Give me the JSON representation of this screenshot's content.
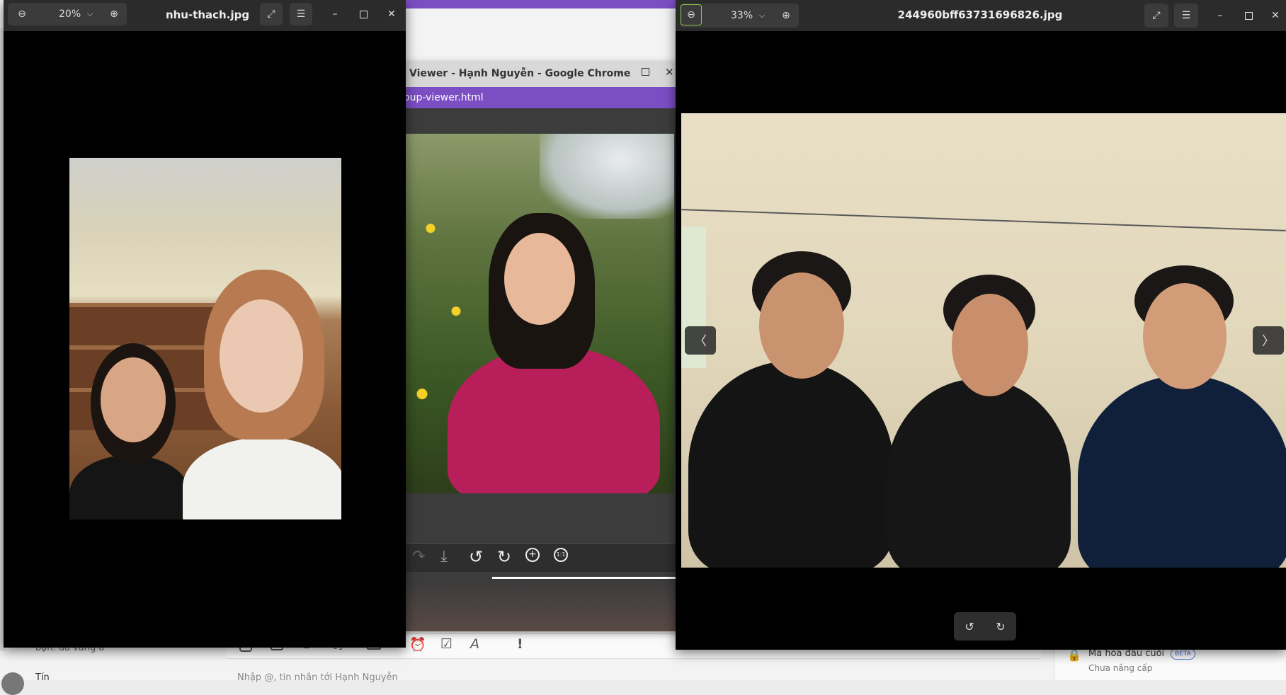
{
  "background_app": {
    "accent_color": "#7b4ec4",
    "chat_preview": "bạn. đã vắng ả",
    "chat_name_partial": "Tín",
    "chat_input_placeholder": "Nhập @, tin nhắn tới Hạnh Nguyễn",
    "encryption_label": "Mã hóa đầu cuối",
    "encryption_badge": "BETA",
    "encryption_sub": "Chưa nâng cấp"
  },
  "left_viewer": {
    "filename": "nhu-thach.jpg",
    "zoom": "20%"
  },
  "chrome_window": {
    "title": "Viewer - Hạnh Nguyễn - Google Chrome",
    "url_partial": "oup-viewer.html"
  },
  "right_viewer": {
    "filename": "244960bff63731696826.jpg",
    "zoom": "33%"
  },
  "icons": {
    "zoom_out": "zoom-out-icon",
    "zoom_in": "zoom-in-icon",
    "fullscreen": "fullscreen-icon",
    "menu": "hamburger-menu-icon",
    "rotate_left": "rotate-left-icon",
    "rotate_right": "rotate-right-icon",
    "prev": "chevron-left-icon",
    "next": "chevron-right-icon"
  }
}
